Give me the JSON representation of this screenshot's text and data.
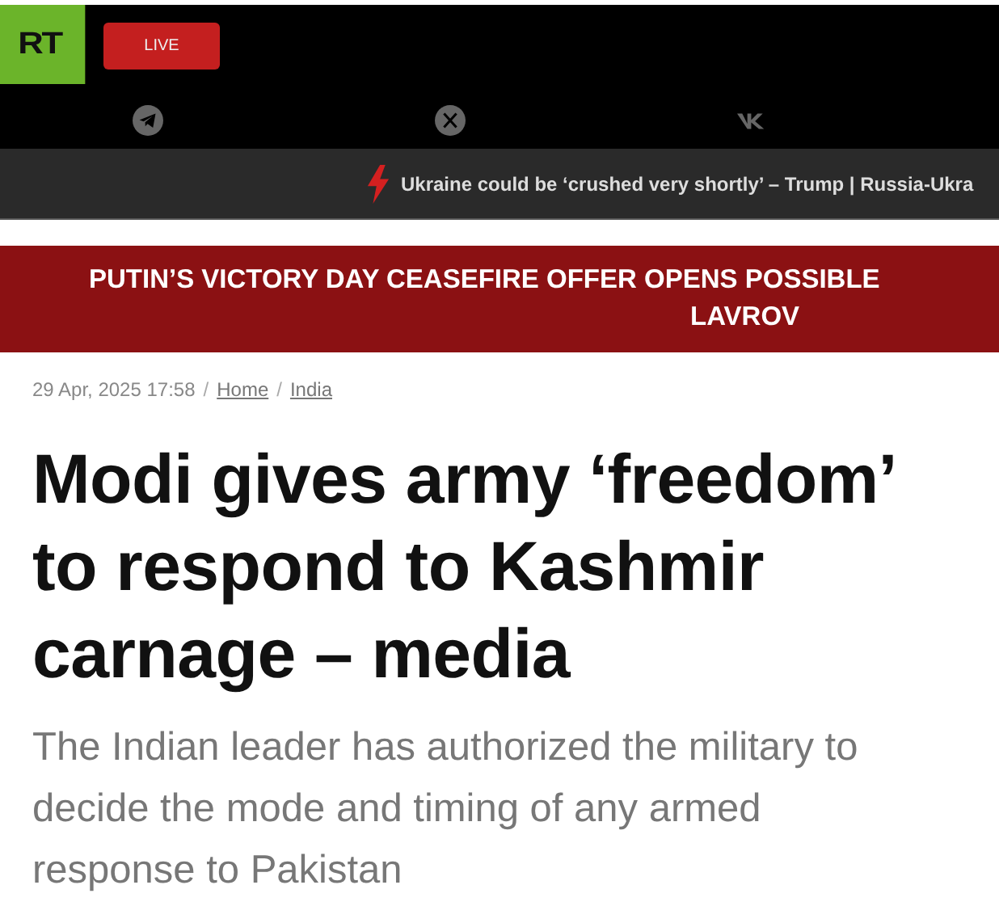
{
  "header": {
    "logo": "RT",
    "live_button": "LIVE",
    "social_links": [
      {
        "kind": "telegram"
      },
      {
        "kind": "x"
      },
      {
        "kind": "vk"
      }
    ]
  },
  "ticker": {
    "text": "Ukraine could be ‘crushed very shortly’ – Trump | Russia-Ukra"
  },
  "banner": {
    "lines": [
      "PUTIN’S VICTORY DAY CEASEFIRE OFFER OPENS POSSIBLE",
      "LAVROV"
    ]
  },
  "article": {
    "date": "29 Apr, 2025 17:58",
    "separator": "/",
    "breadcrumbs": [
      "Home",
      "India"
    ],
    "headline": "Modi gives army ‘freedom’ to respond to Kashmir carnage – media",
    "summary": "The Indian leader has authorized the military to decide the mode and timing of any armed response to Pakistan"
  }
}
